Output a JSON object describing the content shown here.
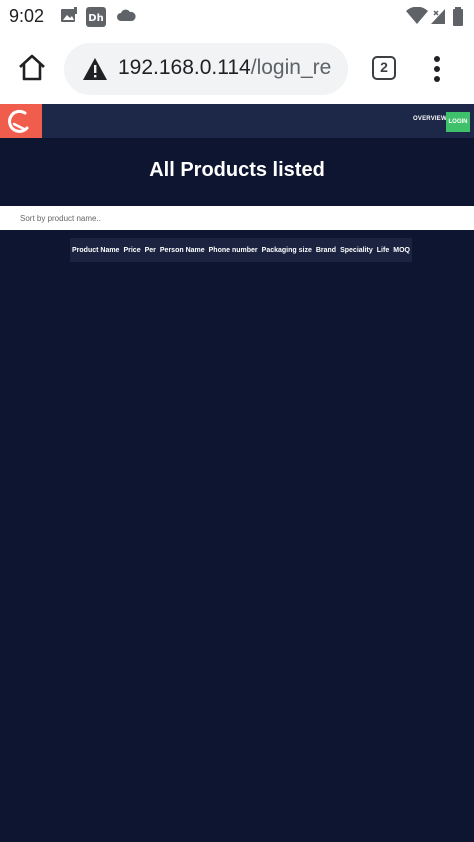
{
  "status_bar": {
    "time": "9:02",
    "icons": [
      "gallery-icon",
      "app-dh-icon",
      "cloud-icon",
      "wifi-icon",
      "signal-icon",
      "battery-icon"
    ]
  },
  "browser": {
    "url_host": "192.168.0.114",
    "url_path": "/login_re",
    "tab_count": "2",
    "icons": [
      "home-icon",
      "warning-icon",
      "tabs-icon",
      "more-vert-icon"
    ]
  },
  "site": {
    "nav": {
      "overview_label": "OVERVIEW",
      "login_label": "LOGIN"
    },
    "title": "All Products listed",
    "sort_placeholder": "Sort by product name..",
    "table": {
      "headers": [
        "Product Name",
        "Price",
        "Per",
        "Person Name",
        "Phone number",
        "Packaging size",
        "Brand",
        "Speciality",
        "Life",
        "MOQ"
      ]
    }
  },
  "colors": {
    "page_bg": "#0e1530",
    "nav_bg": "#1d2747",
    "logo_bg": "#f15d4d",
    "login_bg": "#3ec16a",
    "table_header_bg": "#1b2340"
  }
}
